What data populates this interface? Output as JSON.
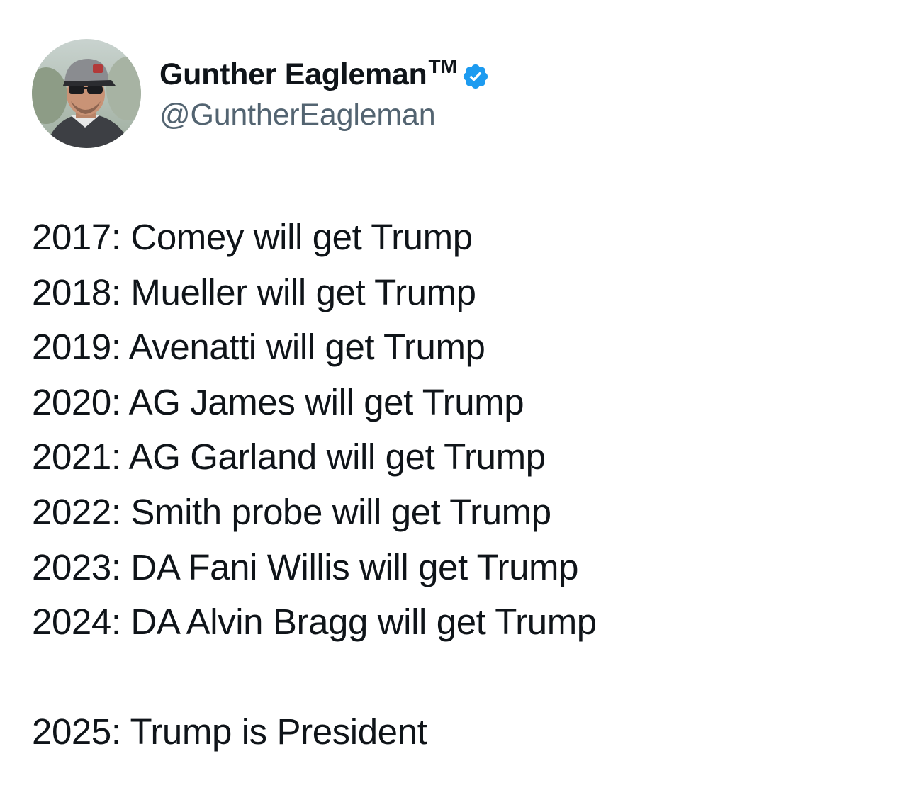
{
  "tweet": {
    "author": {
      "display_name": "Gunther Eagleman",
      "trademark": "TM",
      "handle": "@GuntherEagleman",
      "verified_icon": "verified-badge-icon",
      "badge_color": "#1d9bf0"
    },
    "lines": [
      "2017: Comey will get Trump",
      "2018: Mueller will get Trump",
      "2019: Avenatti will get Trump",
      "2020: AG James will get Trump",
      "2021: AG Garland will get Trump",
      "2022: Smith probe will get Trump",
      "2023: DA Fani Willis will get Trump",
      "2024: DA Alvin Bragg will get Trump"
    ],
    "final_line": "2025: Trump is President"
  }
}
